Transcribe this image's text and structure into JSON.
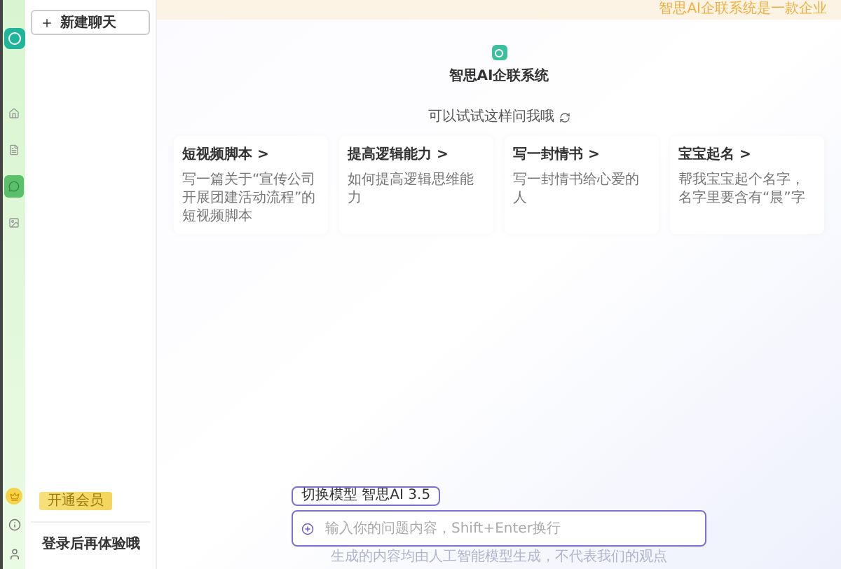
{
  "notice": "智思AI企联系统是一款企业",
  "rail": {
    "items": [
      {
        "kind": "home",
        "selected": false
      },
      {
        "kind": "doc",
        "selected": false
      },
      {
        "kind": "chat",
        "selected": true
      },
      {
        "kind": "image",
        "selected": false
      }
    ]
  },
  "sidebar": {
    "new_chat": "新建聊天",
    "vip_button": "开通会员",
    "login_hint": "登录后再体验哦"
  },
  "hero": {
    "title": "智思AI企联系统",
    "suggest_label": "可以试试这样问我哦"
  },
  "cards": [
    {
      "title": "短视频脚本 >",
      "text": "写一篇关于“宣传公司开展团建活动流程”的短视频脚本"
    },
    {
      "title": "提高逻辑能力 >",
      "text": "如何提高逻辑思维能力"
    },
    {
      "title": "写一封情书 >",
      "text": "写一封情书给心爱的人"
    },
    {
      "title": "宝宝起名 >",
      "text": "帮我宝宝起个名字，名字里要含有“晨”字"
    }
  ],
  "composer": {
    "model": "切换模型 智思AI 3.5",
    "placeholder": "输入你的问题内容，Shift+Enter换行",
    "disclaimer": "生成的内容均由人工智能模型生成，不代表我们的观点"
  }
}
